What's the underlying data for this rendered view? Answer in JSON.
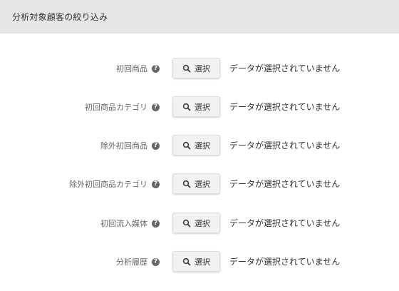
{
  "header": {
    "title": "分析対象顧客の絞り込み"
  },
  "help_icon_glyph": "?",
  "filters": [
    {
      "label": "初回商品",
      "button_label": "選択",
      "status": "データが選択されていません"
    },
    {
      "label": "初回商品カテゴリ",
      "button_label": "選択",
      "status": "データが選択されていません"
    },
    {
      "label": "除外初回商品",
      "button_label": "選択",
      "status": "データが選択されていません"
    },
    {
      "label": "除外初回商品カテゴリ",
      "button_label": "選択",
      "status": "データが選択されていません"
    },
    {
      "label": "初回流入媒体",
      "button_label": "選択",
      "status": "データが選択されていません"
    },
    {
      "label": "分析履歴",
      "button_label": "選択",
      "status": "データが選択されていません"
    }
  ],
  "icons": {
    "help": "question-circle-icon",
    "search": "search-icon"
  }
}
